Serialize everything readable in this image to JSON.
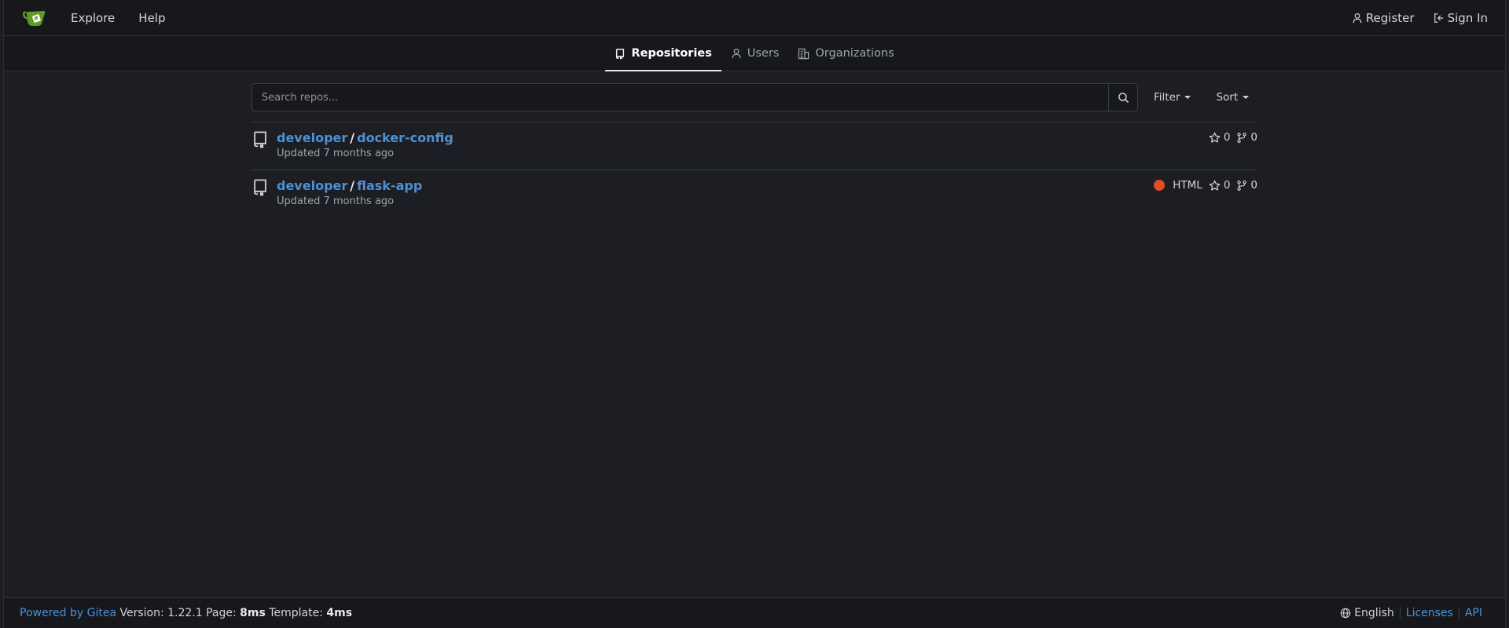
{
  "navbar": {
    "logo_icon": "gitea-teacup-icon",
    "explore": "Explore",
    "help": "Help",
    "register": "Register",
    "sign_in": "Sign In"
  },
  "tabs": [
    {
      "label": "Repositories",
      "icon": "repo-icon",
      "active": true
    },
    {
      "label": "Users",
      "icon": "person-icon",
      "active": false
    },
    {
      "label": "Organizations",
      "icon": "organization-icon",
      "active": false
    }
  ],
  "search": {
    "placeholder": "Search repos...",
    "value": "",
    "filter_label": "Filter",
    "sort_label": "Sort"
  },
  "repos": [
    {
      "owner": "developer",
      "name": "docker-config",
      "updated": "Updated 7 months ago",
      "language": "",
      "stars": "0",
      "forks": "0"
    },
    {
      "owner": "developer",
      "name": "flask-app",
      "updated": "Updated 7 months ago",
      "language": "HTML",
      "language_color": "#e34c26",
      "stars": "0",
      "forks": "0"
    }
  ],
  "footer": {
    "powered_by": "Powered by Gitea",
    "version": "Version: 1.22.1",
    "page_label": "Page:",
    "page_time": "8ms",
    "template_label": "Template:",
    "template_time": "4ms",
    "language": "English",
    "licenses": "Licenses",
    "api": "API"
  },
  "colors": {
    "background": "#1c1e23",
    "navbar": "#17181c",
    "link": "#4c90d6",
    "logo_green": "#609926"
  }
}
